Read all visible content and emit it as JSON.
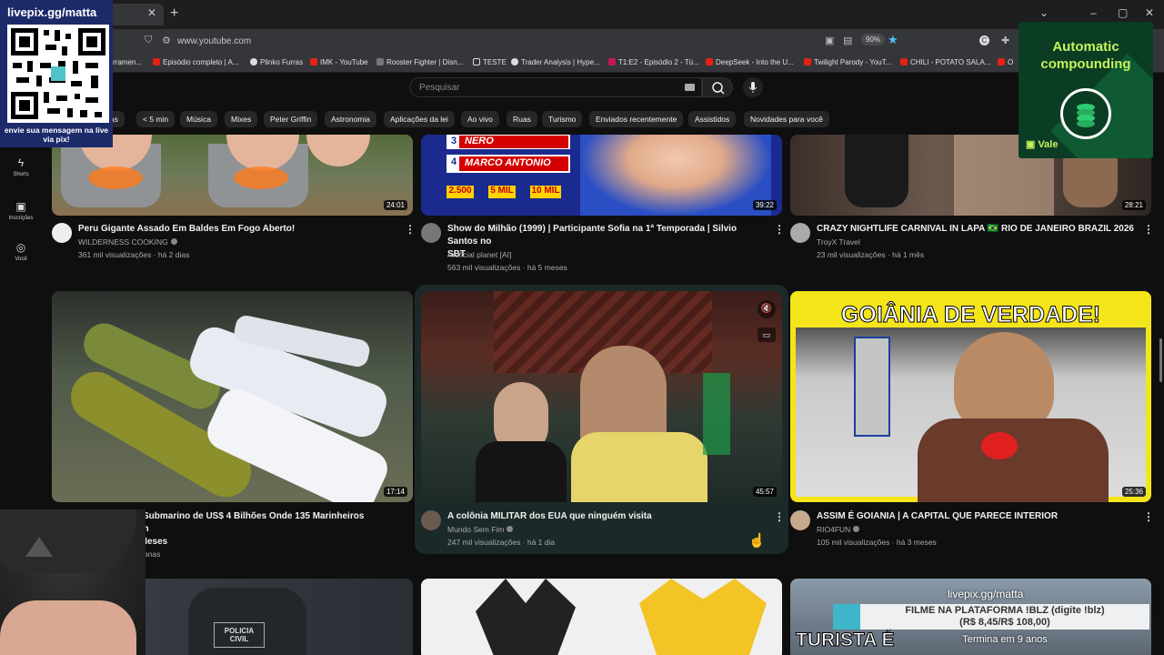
{
  "browser": {
    "url": "www.youtube.com",
    "zoom": "90%",
    "bookmarks": [
      "rramen...",
      "Episódio completo | A...",
      "Plinko Furras",
      "IMK - YouTube",
      "Rooster Fighter | Disn...",
      "TESTE",
      "Trader Analysis | Hype...",
      "T1:E2 - Episódio 2 - Tú...",
      "DeepSeek - Into the U...",
      "Twilight Parody - YouT...",
      "CHILI - POTATO SALA...",
      "O"
    ]
  },
  "youtube": {
    "search_placeholder": "Pesquisar",
    "chips": [
      "ias",
      "< 5 min",
      "Música",
      "Mixes",
      "Peter Griffin",
      "Astronomia",
      "Aplicações da lei",
      "Ao vivo",
      "Ruas",
      "Turismo",
      "Enviados recentemente",
      "Assistidos",
      "Novidades para você"
    ],
    "sidebar": [
      {
        "label": "Shorts",
        "icon": "shorts-icon"
      },
      {
        "label": "Inscrições",
        "icon": "subscriptions-icon"
      },
      {
        "label": "Você",
        "icon": "you-icon"
      }
    ],
    "videos": [
      {
        "title": "Peru Gigante Assado Em Baldes Em Fogo Aberto!",
        "channel": "WILDERNESS COOKING",
        "meta": "361 mil visualizações · há 2 dias",
        "duration": "24:01"
      },
      {
        "title": "Show do Milhão (1999) | Participante Sofia na 1ª Temporada | Silvio Santos no",
        "title2": "SBT",
        "channel": "Artificial planet [AI]",
        "meta": "563 mil visualizações · há 5 meses",
        "duration": "39:22",
        "thumb_text": [
          "NERO",
          "MARCO ANTONIO",
          "2.500",
          "5 MIL",
          "10 MIL"
        ],
        "thumb_nums": [
          "3",
          "4"
        ]
      },
      {
        "title": "CRAZY NIGHTLIFE CARNIVAL IN LAPA 🇧🇷 RIO DE JANEIRO BRAZIL 2026",
        "channel": "TroyX Travel",
        "meta": "23 mil visualizações · há 1 mês",
        "duration": "28:21"
      },
      {
        "title": "Dentro do Submarino de US$ 4 Bilhões Onde 135 Marinheiros Sobrevivem",
        "title2": "Água por Meses",
        "channel": "rtuguese",
        "meta": "há 2 semanas",
        "duration": "17:14"
      },
      {
        "title": "A colônia MILITAR dos EUA que ninguém visita",
        "channel": "Mundo Sem Fim",
        "meta": "247 mil visualizações · há 1 dia",
        "duration": "45:57"
      },
      {
        "title": "ASSIM É GOIANIA | A CAPITAL QUE PARECE INTERIOR",
        "channel": "RIO4FUN",
        "meta": "105 mil visualizações · há 3 meses",
        "duration": "25:36",
        "thumb_text": "GOIÂNIA DE VERDADE!"
      }
    ],
    "row3": {
      "police_text": "POLICIA CIVIL",
      "turista_text": "TURISTA É"
    }
  },
  "overlays": {
    "qr_title": "livepix.gg/matta",
    "qr_caption": "envie sua mensagem na live via pix!",
    "ac_title": "Automatic compounding",
    "ac_vale": "Vale",
    "live_url": "livepix.gg/matta",
    "live_line1": "FILME NA PLATAFORMA !BLZ (digite !blz)",
    "live_line2": "(R$ 8,45/R$ 108,00)",
    "live_line3": "Termina em 9 anos"
  }
}
